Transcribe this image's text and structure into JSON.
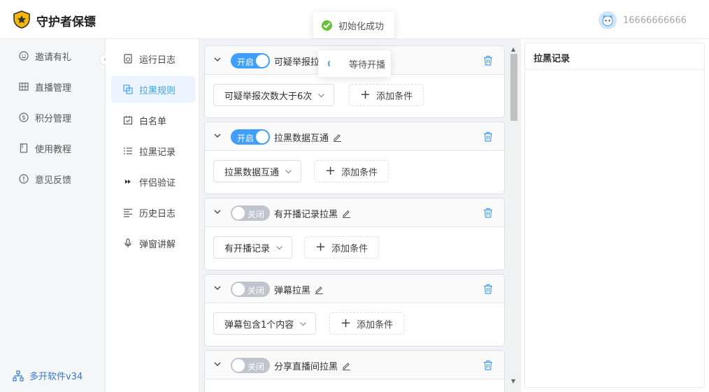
{
  "app": {
    "title": "守护者保镖",
    "user_phone": "16666666666"
  },
  "toasts": {
    "success": "初始化成功",
    "loading": "等待开播"
  },
  "sidebar": {
    "items": [
      {
        "label": "邀请有礼",
        "icon": "smile-icon"
      },
      {
        "label": "直播管理",
        "icon": "grid-icon"
      },
      {
        "label": "积分管理",
        "icon": "dollar-circle-icon"
      },
      {
        "label": "使用教程",
        "icon": "book-icon"
      },
      {
        "label": "意见反馈",
        "icon": "feedback-icon"
      }
    ],
    "version": "多开软件v34"
  },
  "submenu": {
    "items": [
      {
        "label": "运行日志",
        "icon": "log-icon"
      },
      {
        "label": "拉黑规则",
        "icon": "copy-icon",
        "active": true
      },
      {
        "label": "白名单",
        "icon": "calendar-check-icon"
      },
      {
        "label": "拉黑记录",
        "icon": "list-icon"
      },
      {
        "label": "伴侣验证",
        "icon": "fast-forward-icon"
      },
      {
        "label": "历史日志",
        "icon": "align-left-icon"
      },
      {
        "label": "弹窗讲解",
        "icon": "microphone-icon"
      }
    ]
  },
  "switch_labels": {
    "on": "开启",
    "off": "关闭"
  },
  "rules": [
    {
      "name": "可疑举报拉",
      "enabled": true,
      "condition": "可疑举报次数大于6次",
      "add_label": "添加条件"
    },
    {
      "name": "拉黑数据互通",
      "enabled": true,
      "condition": "拉黑数据互通",
      "add_label": "添加条件"
    },
    {
      "name": "有开播记录拉黑",
      "enabled": false,
      "condition": "有开播记录",
      "add_label": "添加条件"
    },
    {
      "name": "弹幕拉黑",
      "enabled": false,
      "condition": "弹幕包含1个内容",
      "add_label": "添加条件"
    },
    {
      "name": "分享直播间拉黑",
      "enabled": false,
      "condition": "",
      "add_label": ""
    }
  ],
  "right_panel": {
    "title": "拉黑记录"
  },
  "colors": {
    "primary": "#409eff",
    "success": "#67c23a",
    "switch_off": "#c0c4cc"
  }
}
